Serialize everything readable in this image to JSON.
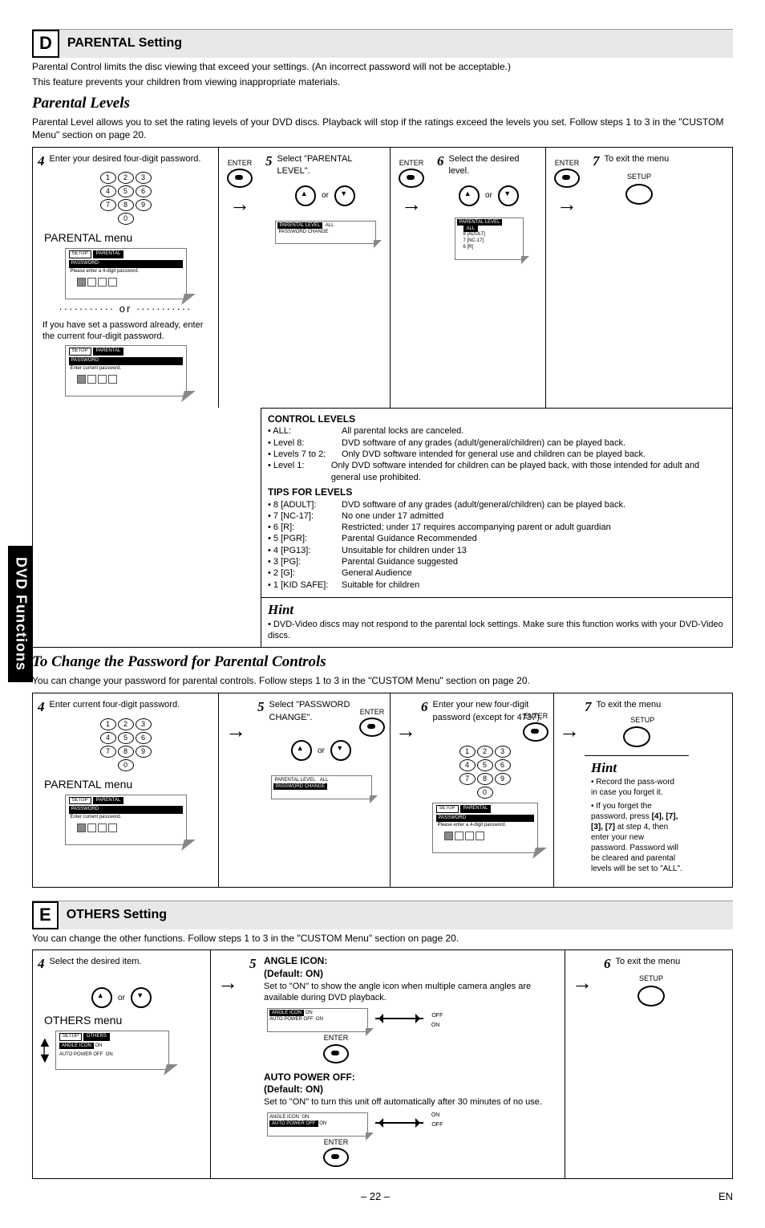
{
  "side_tab": "DVD Functions",
  "section_d": {
    "letter": "D",
    "title": "PARENTAL Setting",
    "intro1": "Parental Control limits the disc viewing that exceed your settings. (An incorrect password will not be acceptable.)",
    "intro2": "This feature prevents your children from viewing inappropriate materials.",
    "sub1_title": "Parental Levels",
    "sub1_text": "Parental Level allows you to set the rating levels of your DVD discs. Playback will stop if the ratings exceed the levels you set. Follow steps 1 to 3 in the \"CUSTOM Menu\" section on page 20.",
    "step4": "Enter your desired four-digit password.",
    "menu_label": "PARENTAL menu",
    "osd1": {
      "setup": "SETUP",
      "parental": "PARENTAL",
      "password": "PASSWORD",
      "prompt": "Please enter a 4-digit password."
    },
    "altnote": "If you have set a password already, enter the current four-digit password.",
    "osd1b_prompt": "Enter current password.",
    "enter": "ENTER",
    "step5": "Select \"PARENTAL LEVEL\".",
    "osd5": {
      "pl": "PARENTAL LEVEL",
      "pc": "PASSWORD CHANGE",
      "all": "ALL"
    },
    "step6": "Select the desired level.",
    "osd6_items": [
      "ALL",
      "8 [ADULT]",
      "7 [NC-17]",
      "6 [R]"
    ],
    "step7": "To exit the menu",
    "setup_label": "SETUP",
    "ctrl_title": "CONTROL LEVELS",
    "ctrl": [
      {
        "k": "• ALL:",
        "v": "All parental locks are canceled."
      },
      {
        "k": "• Level 8:",
        "v": "DVD software of any grades (adult/general/children) can be played back."
      },
      {
        "k": "• Levels 7 to 2:",
        "v": "Only DVD software intended for general use and children can be played back."
      },
      {
        "k": "• Level 1:",
        "v": "Only DVD software intended for children can be played back, with those intended for adult and general use prohibited."
      }
    ],
    "tips_title": "TIPS FOR LEVELS",
    "tips": [
      {
        "k": "• 8 [ADULT]:",
        "v": "DVD software of any grades (adult/general/children) can be played back."
      },
      {
        "k": "• 7 [NC-17]:",
        "v": "No one under 17 admitted"
      },
      {
        "k": "• 6 [R]:",
        "v": "Restricted; under 17 requires accompanying parent or adult guardian"
      },
      {
        "k": "• 5 [PGR]:",
        "v": "Parental Guidance Recommended"
      },
      {
        "k": "• 4 [PG13]:",
        "v": "Unsuitable for children under 13"
      },
      {
        "k": "• 3 [PG]:",
        "v": "Parental Guidance suggested"
      },
      {
        "k": "• 2 [G]:",
        "v": "General Audience"
      },
      {
        "k": "• 1 [KID SAFE]:",
        "v": "Suitable for children"
      }
    ],
    "hint_title": "Hint",
    "hint_text": "• DVD-Video discs may not respond to the parental lock settings. Make sure this function works with your DVD-Video discs.",
    "sub2_title": "To Change the Password for Parental Controls",
    "sub2_text": "You can change your password for parental controls.  Follow steps 1 to 3 in the \"CUSTOM Menu\" section on page 20.",
    "pw_step4": "Enter current four-digit password.",
    "pw_step5": "Select \"PASSWORD CHANGE\".",
    "pw_step6": "Enter your new four-digit password (except for 4737).",
    "pw_step7": "To exit the menu",
    "hint2_text": "• Record the pass-word in case you forget it.",
    "hint2_text2": "• If you forget the password, press [4], [7], [3], [7] at step 4, then enter your new password. Password will be cleared and parental levels will be set to \"ALL\"."
  },
  "section_e": {
    "letter": "E",
    "title": "OTHERS Setting",
    "intro": "You can change the other functions. Follow steps 1 to 3 in the \"CUSTOM Menu\" section on page 20.",
    "step4": "Select the desired item.",
    "menu_label": "OTHERS menu",
    "osd": {
      "setup": "SETUP",
      "others": "OTHERS",
      "angle": "ANGLE ICON",
      "auto": "AUTO POWER OFF",
      "on": "ON"
    },
    "angle_title": "ANGLE ICON:",
    "angle_def": "(Default: ON)",
    "angle_text": "Set to \"ON\" to show the angle icon when multiple camera angles are available during DVD playback.",
    "auto_title": "AUTO POWER OFF:",
    "auto_def": "(Default: ON)",
    "auto_text": "Set to \"ON\" to turn this unit off automatically after 30 minutes of no use.",
    "on": "ON",
    "off": "OFF",
    "step6": "To exit the menu"
  },
  "or": "or",
  "footer": {
    "page": "– 22 –",
    "lang": "EN"
  }
}
